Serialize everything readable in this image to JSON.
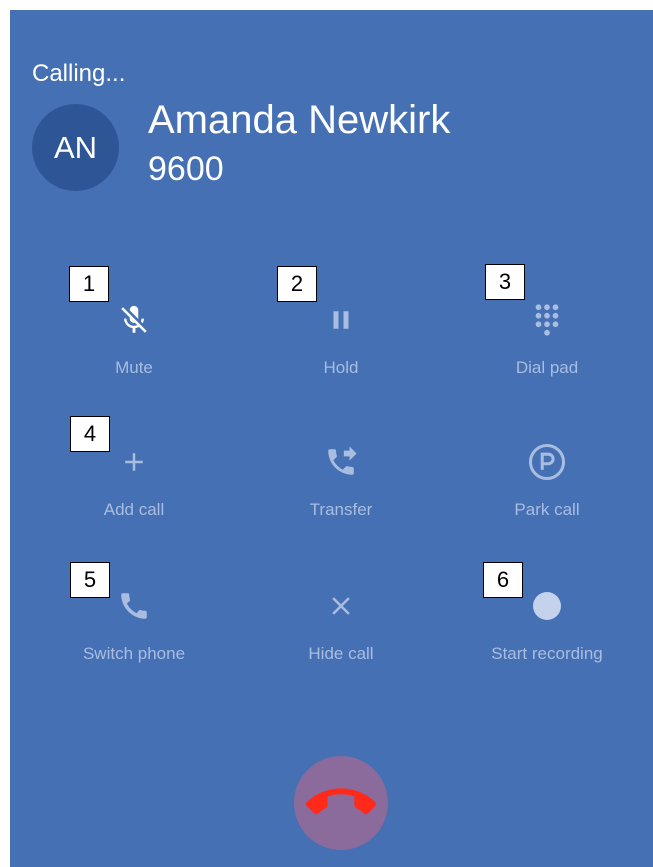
{
  "call": {
    "status": "Calling...",
    "avatar_initials": "AN",
    "caller_name": "Amanda Newkirk",
    "caller_number": "9600"
  },
  "actions": {
    "mute": {
      "label": "Mute",
      "icon": "mic-off-icon"
    },
    "hold": {
      "label": "Hold",
      "icon": "pause-icon"
    },
    "dialpad": {
      "label": "Dial pad",
      "icon": "dialpad-icon"
    },
    "add_call": {
      "label": "Add call",
      "icon": "plus-icon"
    },
    "transfer": {
      "label": "Transfer",
      "icon": "phone-forward-icon"
    },
    "park_call": {
      "label": "Park call",
      "icon": "parking-icon"
    },
    "switch_phone": {
      "label": "Switch phone",
      "icon": "phone-icon"
    },
    "hide_call": {
      "label": "Hide call",
      "icon": "close-icon"
    },
    "start_recording": {
      "label": "Start recording",
      "icon": "record-dot-icon"
    }
  },
  "markers": [
    "1",
    "2",
    "3",
    "4",
    "5",
    "6"
  ],
  "hangup": {
    "icon": "hangup-icon",
    "color": "#ff2a1a"
  },
  "colors": {
    "panel_background": "#4570b4",
    "avatar_background": "#2e5696",
    "action_color": "#a9bde0",
    "hangup_background": "#8b6b9b"
  }
}
